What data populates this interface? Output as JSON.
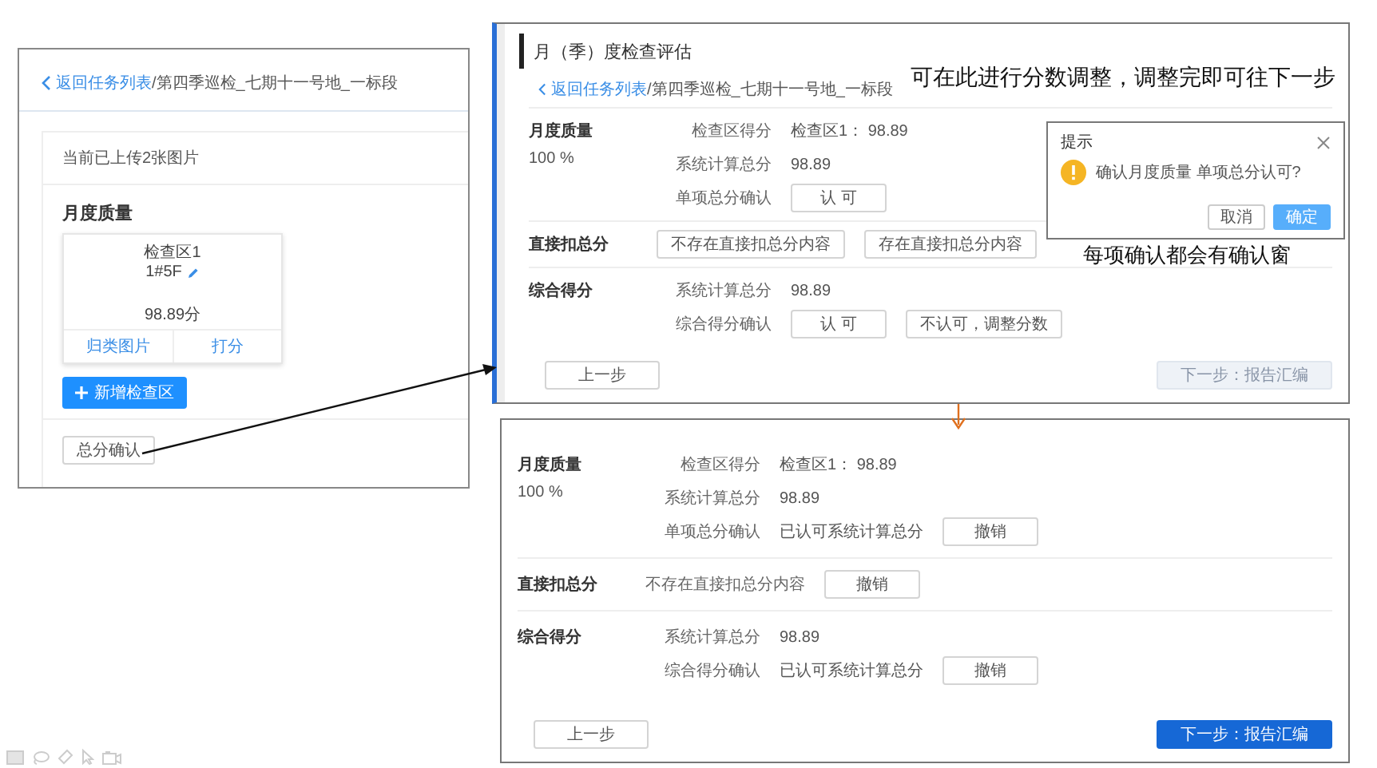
{
  "mobile_panel": {
    "breadcrumb_link": "返回任务列表",
    "breadcrumb_path": "/第四季巡检_七期十一号地_一标段",
    "upload_info": "当前已上传2张图片",
    "section_title": "月度质量",
    "area_card": {
      "name": "检查区1",
      "code": "1#5F",
      "score": "98.89分",
      "actions": [
        "归类图片",
        "打分"
      ]
    },
    "add_button": "新增检查区",
    "confirm_button": "总分确认"
  },
  "evaluation_panel": {
    "title": "月（季）度检查评估",
    "breadcrumb_link": "返回任务列表",
    "breadcrumb_path": "/第四季巡检_七期十一号地_一标段",
    "sections": [
      {
        "title": "月度质量",
        "weight": "100 %",
        "rows": [
          {
            "label": "检查区得分",
            "value": "检查区1： 98.89"
          },
          {
            "label": "系统计算总分",
            "value": "98.89"
          },
          {
            "label": "单项总分确认",
            "buttons": [
              "认 可"
            ]
          }
        ]
      },
      {
        "title": "直接扣总分",
        "rows": [
          {
            "buttons": [
              "不存在直接扣总分内容",
              "存在直接扣总分内容"
            ]
          }
        ]
      },
      {
        "title": "综合得分",
        "rows": [
          {
            "label": "系统计算总分",
            "value": "98.89"
          },
          {
            "label": "综合得分确认",
            "buttons": [
              "认 可",
              "不认可，调整分数"
            ]
          }
        ]
      }
    ],
    "prev_button": "上一步",
    "next_button": {
      "label": "下一步：报告汇编",
      "disabled": true
    }
  },
  "dialog": {
    "title": "提示",
    "message": "确认月度质量 单项总分认可?",
    "buttons": [
      {
        "label": "取消",
        "primary": false
      },
      {
        "label": "确定",
        "primary": true
      }
    ]
  },
  "result_panel": {
    "sections": [
      {
        "title": "月度质量",
        "weight": "100 %",
        "rows": [
          {
            "label": "检查区得分",
            "value": "检查区1： 98.89"
          },
          {
            "label": "系统计算总分",
            "value": "98.89"
          },
          {
            "label": "单项总分确认",
            "value": "已认可系统计算总分",
            "buttons": [
              "撤销"
            ]
          }
        ]
      },
      {
        "title": "直接扣总分",
        "rows": [
          {
            "label": "不存在直接扣总分内容",
            "buttons": [
              "撤销"
            ]
          }
        ]
      },
      {
        "title": "综合得分",
        "rows": [
          {
            "label": "系统计算总分",
            "value": "98.89"
          },
          {
            "label": "综合得分确认",
            "value": "已认可系统计算总分",
            "buttons": [
              "撤销"
            ]
          }
        ]
      }
    ],
    "prev_button": "上一步",
    "next_button": {
      "label": "下一步：报告汇编",
      "disabled": false
    }
  },
  "annotations": [
    "可在此进行分数调整，调整完即可往下一步",
    "每项确认都会有确认窗"
  ]
}
